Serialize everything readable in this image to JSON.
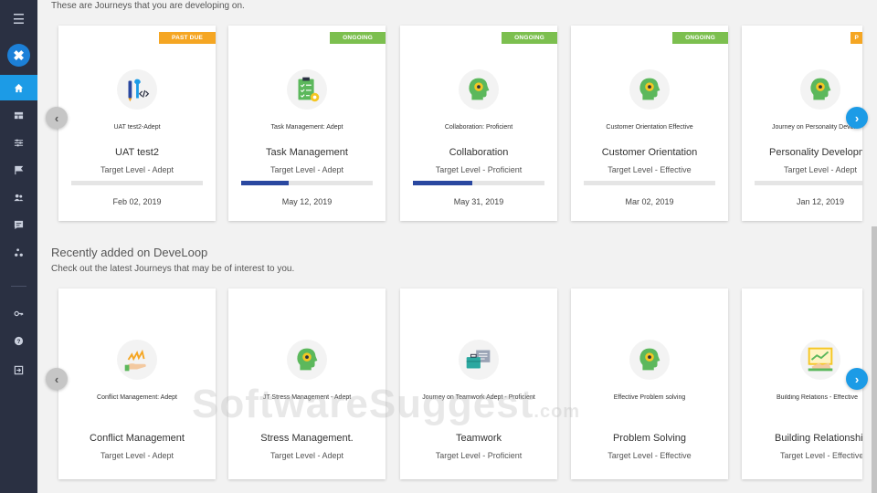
{
  "sidebar": {
    "items": [
      {
        "icon": "home-icon",
        "active": true
      },
      {
        "icon": "dashboard-icon",
        "active": false
      },
      {
        "icon": "sliders-icon",
        "active": false
      },
      {
        "icon": "flag-icon",
        "active": false
      },
      {
        "icon": "people-icon",
        "active": false
      },
      {
        "icon": "chat-icon",
        "active": false
      },
      {
        "icon": "network-icon",
        "active": false
      },
      {
        "icon": "key-icon",
        "active": false
      },
      {
        "icon": "help-icon",
        "active": false
      },
      {
        "icon": "logout-icon",
        "active": false
      }
    ]
  },
  "developing": {
    "intro": "These are Journeys that you are developing on.",
    "cards": [
      {
        "badge": "PAST DUE",
        "badge_type": "past-due",
        "icon": "tools-icon",
        "small_title": "UAT test2-Adept",
        "title": "UAT test2",
        "target": "Target Level - Adept",
        "progress": 0,
        "date": "Feb 02, 2019"
      },
      {
        "badge": "ONGOING",
        "badge_type": "ongoing",
        "icon": "checklist-icon",
        "small_title": "Task Management: Adept",
        "title": "Task Management",
        "target": "Target Level - Adept",
        "progress": 0.36,
        "date": "May 12, 2019"
      },
      {
        "badge": "ONGOING",
        "badge_type": "ongoing",
        "icon": "head-gear-icon",
        "small_title": "Collaboration: Proficient",
        "title": "Collaboration",
        "target": "Target Level - Proficient",
        "progress": 0.45,
        "date": "May 31, 2019"
      },
      {
        "badge": "ONGOING",
        "badge_type": "ongoing",
        "icon": "head-gear-icon",
        "small_title": "Customer Orientation Effective",
        "title": "Customer Orientation",
        "target": "Target Level - Effective",
        "progress": 0,
        "date": "Mar 02, 2019"
      },
      {
        "badge": "P",
        "badge_type": "past-due",
        "icon": "head-gear-icon",
        "small_title": "Journey on Personality Devel",
        "title": "Personality Developme",
        "target": "Target Level - Adept",
        "progress": 0,
        "date": "Jan 12, 2019"
      }
    ]
  },
  "recent": {
    "title": "Recently added on DeveLoop",
    "subtitle": "Check out the latest Journeys that may be of interest to you.",
    "cards": [
      {
        "icon": "hand-spark-icon",
        "small_title": "Conflict Management: Adept",
        "title": "Conflict Management",
        "target": "Target Level - Adept"
      },
      {
        "icon": "head-gear-icon",
        "small_title": "JT Stress Management - Adept",
        "title": "Stress Management.",
        "target": "Target Level - Adept"
      },
      {
        "icon": "briefcase-icon",
        "small_title": "Journey on Teamwork Adept - Proficient",
        "title": "Teamwork",
        "target": "Target Level - Proficient"
      },
      {
        "icon": "head-gear-icon",
        "small_title": "Effective Problem solving",
        "title": "Problem Solving",
        "target": "Target Level - Effective"
      },
      {
        "icon": "handshake-chart-icon",
        "small_title": "Building Relations - Effective",
        "title": "Building Relationships",
        "target": "Target Level - Effective"
      }
    ]
  },
  "watermark": {
    "main": "SoftwareSuggest",
    "suffix": ".com"
  },
  "colors": {
    "sidebar": "#2a3042",
    "accent": "#1c9be6",
    "past_due": "#f5a623",
    "ongoing": "#7cbf4f",
    "progress": "#2a48a0"
  }
}
